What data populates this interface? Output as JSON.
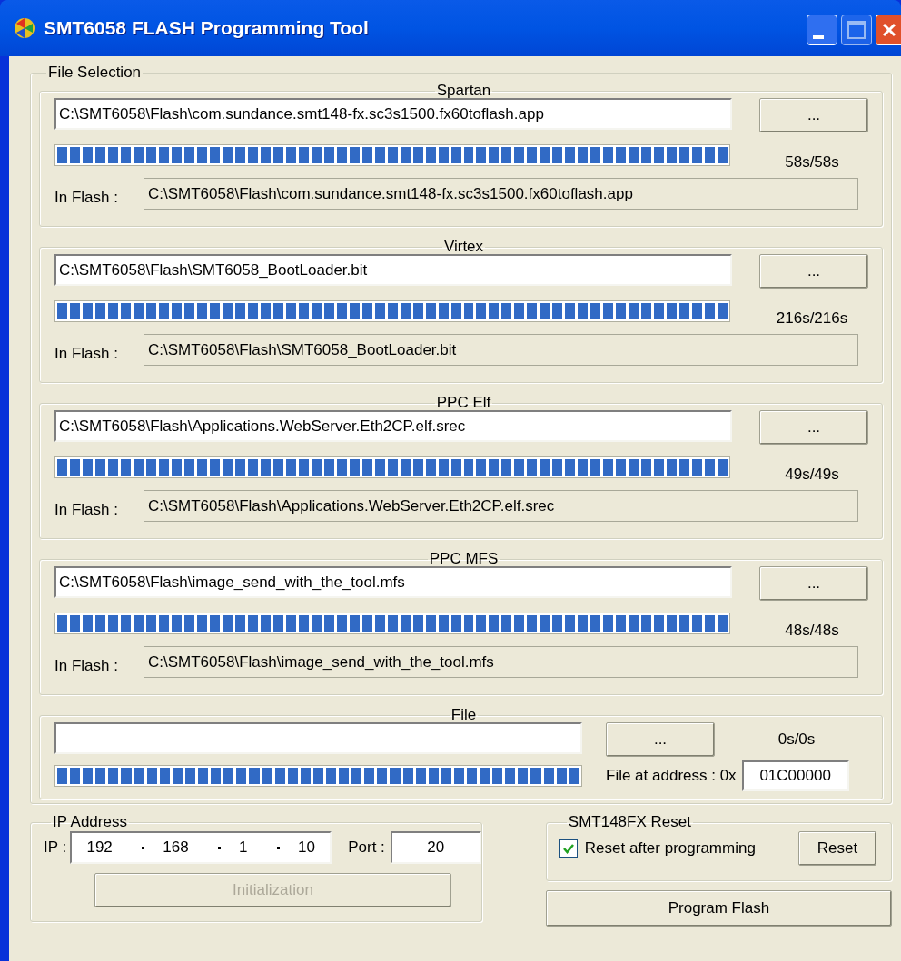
{
  "window": {
    "title": "SMT6058 FLASH Programming Tool"
  },
  "file_selection": {
    "title": "File Selection",
    "groups": [
      {
        "title": "Spartan",
        "path": "C:\\SMT6058\\Flash\\com.sundance.smt148-fx.sc3s1500.fx60toflash.app",
        "browse": "...",
        "level": 1,
        "time": "58s/58s",
        "in_flash_label": "In Flash :",
        "in_flash": "C:\\SMT6058\\Flash\\com.sundance.smt148-fx.sc3s1500.fx60toflash.app"
      },
      {
        "title": "Virtex",
        "path": "C:\\SMT6058\\Flash\\SMT6058_BootLoader.bit",
        "browse": "...",
        "level": 1,
        "time": "216s/216s",
        "in_flash_label": "In Flash :",
        "in_flash": "C:\\SMT6058\\Flash\\SMT6058_BootLoader.bit"
      },
      {
        "title": "PPC Elf",
        "path": "C:\\SMT6058\\Flash\\Applications.WebServer.Eth2CP.elf.srec",
        "browse": "...",
        "level": 1,
        "time": "49s/49s",
        "in_flash_label": "In Flash :",
        "in_flash": "C:\\SMT6058\\Flash\\Applications.WebServer.Eth2CP.elf.srec"
      },
      {
        "title": "PPC MFS",
        "path": "C:\\SMT6058\\Flash\\image_send_with_the_tool.mfs",
        "browse": "...",
        "level": 1,
        "time": "48s/48s",
        "in_flash_label": "In Flash :",
        "in_flash": "C:\\SMT6058\\Flash\\image_send_with_the_tool.mfs"
      }
    ],
    "file": {
      "title": "File",
      "browse": "...",
      "time": "0s/0s",
      "level": 1,
      "address_label": "File at address : 0x",
      "address": "01C00000"
    }
  },
  "ip_address": {
    "title": "IP Address",
    "ip_label": "IP :",
    "octets": [
      "192",
      "168",
      "1",
      "10"
    ],
    "port_label": "Port :",
    "port": "20",
    "init_button": {
      "label": "Initialization",
      "disabled": true
    }
  },
  "reset": {
    "title": "SMT148FX Reset",
    "checkbox": {
      "label": "Reset after programming",
      "checked": true
    },
    "button": "Reset"
  },
  "program_button": "Program Flash"
}
